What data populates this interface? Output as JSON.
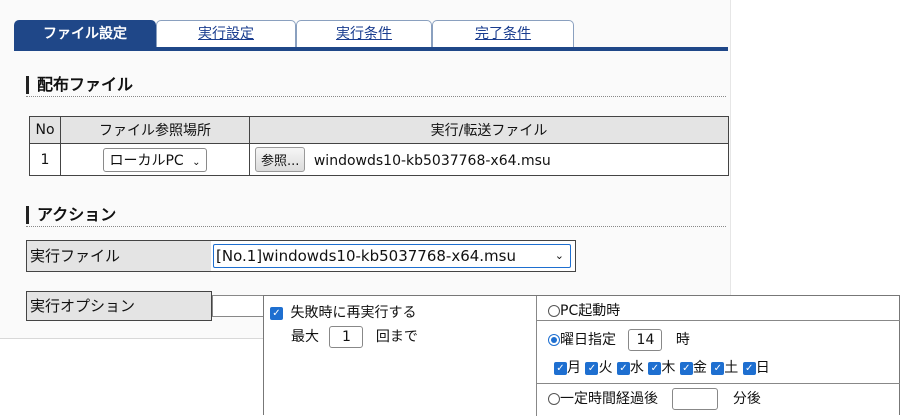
{
  "tabs": [
    {
      "label": "ファイル設定",
      "active": true
    },
    {
      "label": "実行設定",
      "active": false
    },
    {
      "label": "実行条件",
      "active": false
    },
    {
      "label": "完了条件",
      "active": false
    }
  ],
  "distribution": {
    "heading": "配布ファイル",
    "columns": [
      "No",
      "ファイル参照場所",
      "実行/転送ファイル"
    ],
    "rows": [
      {
        "no": "1",
        "location": "ローカルPC",
        "browse": "参照...",
        "file": "windowds10-kb5037768-x64.msu"
      }
    ]
  },
  "action": {
    "heading": "アクション",
    "exec_file_label": "実行ファイル",
    "exec_file_value": "[No.1]windowds10-kb5037768-x64.msu",
    "exec_option_label": "実行オプション"
  },
  "retry": {
    "checkbox_label": "失敗時に再実行する",
    "checked": true,
    "max_label": "最大",
    "max_value": "1",
    "max_suffix": "回まで"
  },
  "schedule": {
    "pc_boot_label": "PC起動時",
    "weekday_label": "曜日指定",
    "hour_value": "14",
    "hour_suffix": "時",
    "days": [
      "月",
      "火",
      "水",
      "木",
      "金",
      "土",
      "日"
    ],
    "interval_label": "一定時間経過後",
    "interval_value": "",
    "interval_suffix": "分後",
    "selected": "weekday"
  },
  "colors": {
    "accent": "#1f4788",
    "checkbox": "#1e6fd0",
    "header_bg": "#e4e4e4"
  }
}
